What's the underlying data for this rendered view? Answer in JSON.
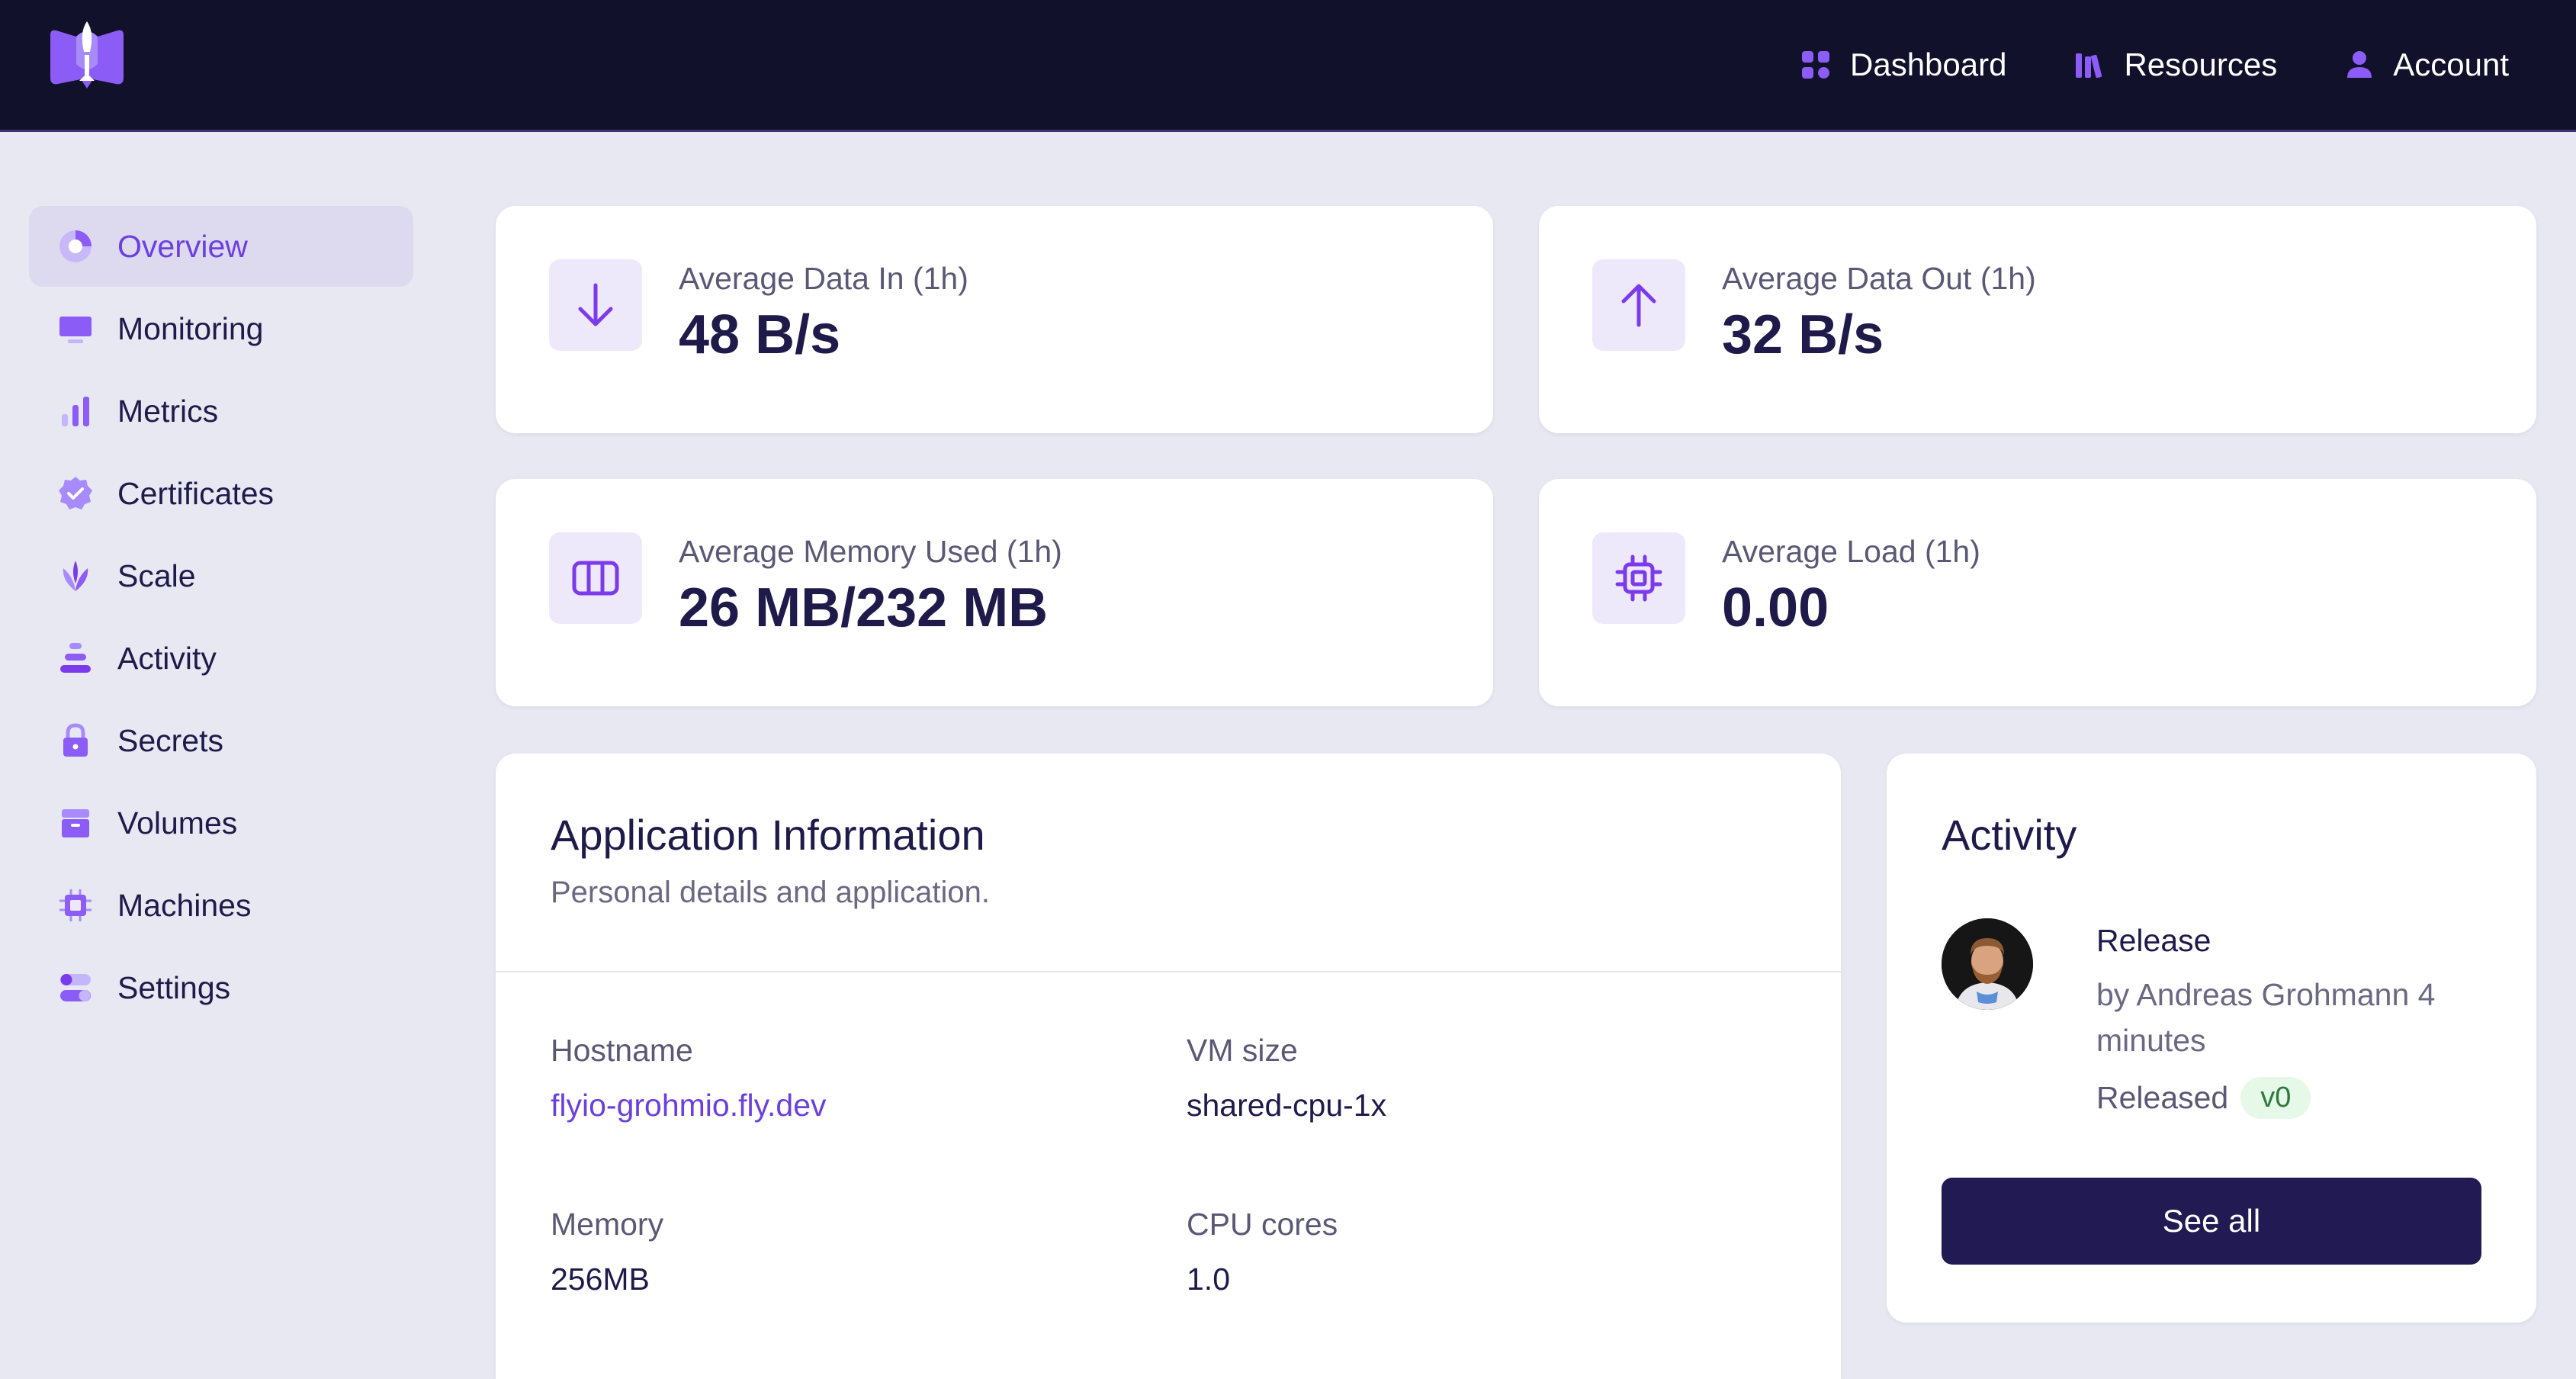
{
  "nav": {
    "items": [
      {
        "label": "Dashboard",
        "icon": "grid-icon"
      },
      {
        "label": "Resources",
        "icon": "library-icon"
      },
      {
        "label": "Account",
        "icon": "user-icon"
      }
    ]
  },
  "sidebar": {
    "items": [
      {
        "label": "Overview",
        "icon": "chart-pie-icon",
        "active": true
      },
      {
        "label": "Monitoring",
        "icon": "monitor-icon"
      },
      {
        "label": "Metrics",
        "icon": "bar-chart-icon"
      },
      {
        "label": "Certificates",
        "icon": "badge-check-icon"
      },
      {
        "label": "Scale",
        "icon": "sprout-icon"
      },
      {
        "label": "Activity",
        "icon": "stack-icon"
      },
      {
        "label": "Secrets",
        "icon": "lock-icon"
      },
      {
        "label": "Volumes",
        "icon": "archive-box-icon"
      },
      {
        "label": "Machines",
        "icon": "cpu-chip-icon"
      },
      {
        "label": "Settings",
        "icon": "toggles-icon"
      }
    ]
  },
  "stats": [
    {
      "label": "Average Data In (1h)",
      "value": "48 B/s",
      "icon": "arrow-down-icon"
    },
    {
      "label": "Average Data Out (1h)",
      "value": "32 B/s",
      "icon": "arrow-up-icon"
    },
    {
      "label": "Average Memory Used (1h)",
      "value": "26 MB/232 MB",
      "icon": "memory-columns-icon"
    },
    {
      "label": "Average Load (1h)",
      "value": "0.00",
      "icon": "cpu-chip-icon"
    }
  ],
  "app_info": {
    "title": "Application Information",
    "subtitle": "Personal details and application.",
    "fields": [
      {
        "label": "Hostname",
        "value": "flyio-grohmio.fly.dev"
      },
      {
        "label": "VM size",
        "value": "shared-cpu-1x"
      },
      {
        "label": "Memory",
        "value": "256MB"
      },
      {
        "label": "CPU cores",
        "value": "1.0"
      }
    ]
  },
  "activity": {
    "title": "Activity",
    "event": "Release",
    "by": "by Andreas Grohmann 4 minutes",
    "released_label": "Released",
    "version": "v0",
    "see_all": "See all"
  },
  "colors": {
    "topbar": "#12112B",
    "accent": "#6B3FE0",
    "background": "#E8E8F2",
    "button": "#221A52"
  }
}
